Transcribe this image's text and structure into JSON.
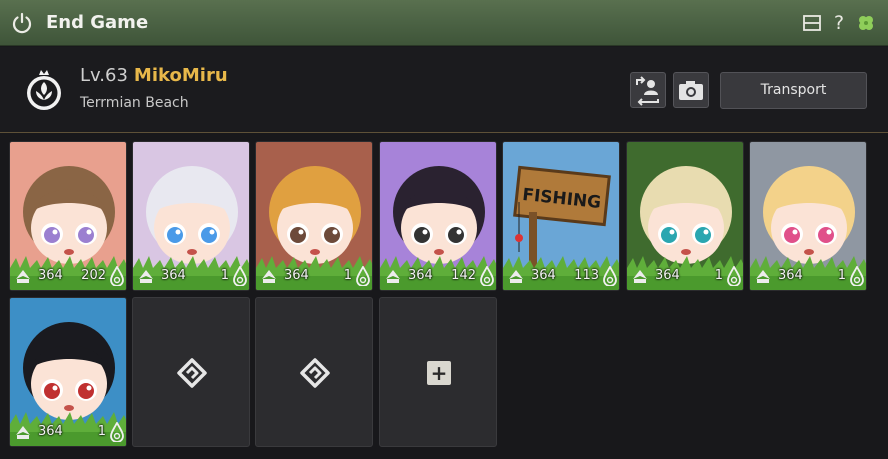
{
  "window": {
    "title": "End Game",
    "icons": [
      "power-icon",
      "window-icon",
      "help-icon",
      "clover-icon"
    ],
    "help_glyph": "?"
  },
  "character": {
    "level_prefix": "Lv.",
    "level": "63",
    "name": "MikoMiru",
    "location": "Terrmian Beach"
  },
  "actions": {
    "swap_icon": "swap-character-icon",
    "camera_icon": "camera-icon",
    "transport_label": "Transport"
  },
  "colors": {
    "accent_name": "#e8b84a",
    "titlebar": "#4a6143",
    "divider": "#5e5138"
  },
  "characters": [
    {
      "level": "364",
      "count": "202",
      "bg": "#e8a08e"
    },
    {
      "level": "364",
      "count": "1",
      "bg": "#d9c6e3"
    },
    {
      "level": "364",
      "count": "1",
      "bg": "#a8604c"
    },
    {
      "level": "364",
      "count": "142",
      "bg": "#a783d9"
    },
    {
      "level": "364",
      "count": "113",
      "bg": "#6aa6d6",
      "sign": "FISHING"
    },
    {
      "level": "364",
      "count": "1",
      "bg": "#3f6b2e"
    },
    {
      "level": "364",
      "count": "1",
      "bg": "#8f97a2"
    },
    {
      "level": "364",
      "count": "1",
      "bg": "#3d8fc6"
    }
  ],
  "empty_slots": [
    {
      "icon": "empty-slot-icon"
    },
    {
      "icon": "empty-slot-icon"
    },
    {
      "icon": "add-slot-icon",
      "glyph": "+"
    }
  ]
}
